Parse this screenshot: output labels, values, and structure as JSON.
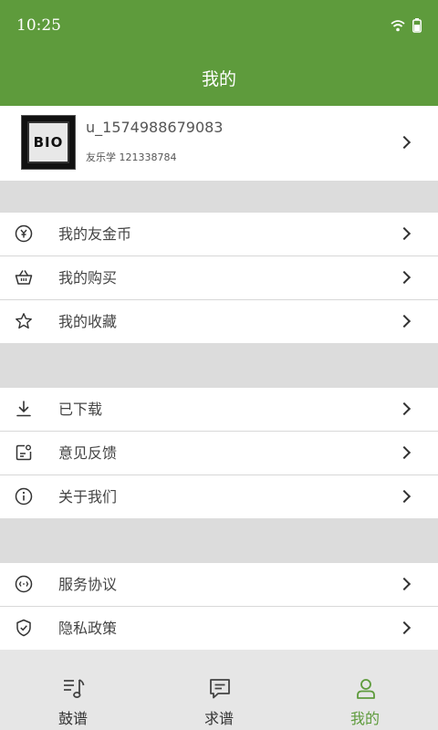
{
  "status": {
    "time": "10:25"
  },
  "header": {
    "title": "我的"
  },
  "profile": {
    "avatar_text": "BIO",
    "username": "u_1574988679083",
    "subtitle": "友乐学 121338784"
  },
  "menu_groups": [
    [
      {
        "label": "我的友金币",
        "icon": "coin-icon"
      },
      {
        "label": "我的购买",
        "icon": "basket-icon"
      },
      {
        "label": "我的收藏",
        "icon": "star-icon"
      }
    ],
    [
      {
        "label": "已下载",
        "icon": "download-icon"
      },
      {
        "label": "意见反馈",
        "icon": "feedback-icon"
      },
      {
        "label": "关于我们",
        "icon": "info-icon"
      }
    ],
    [
      {
        "label": "服务协议",
        "icon": "agreement-icon"
      },
      {
        "label": "隐私政策",
        "icon": "shield-icon"
      }
    ]
  ],
  "tabbar": {
    "tabs": [
      {
        "label": "鼓谱",
        "icon": "score-icon",
        "active": false
      },
      {
        "label": "求谱",
        "icon": "message-icon",
        "active": false
      },
      {
        "label": "我的",
        "icon": "user-icon",
        "active": true
      }
    ]
  },
  "colors": {
    "brand": "#5e9b3c"
  }
}
